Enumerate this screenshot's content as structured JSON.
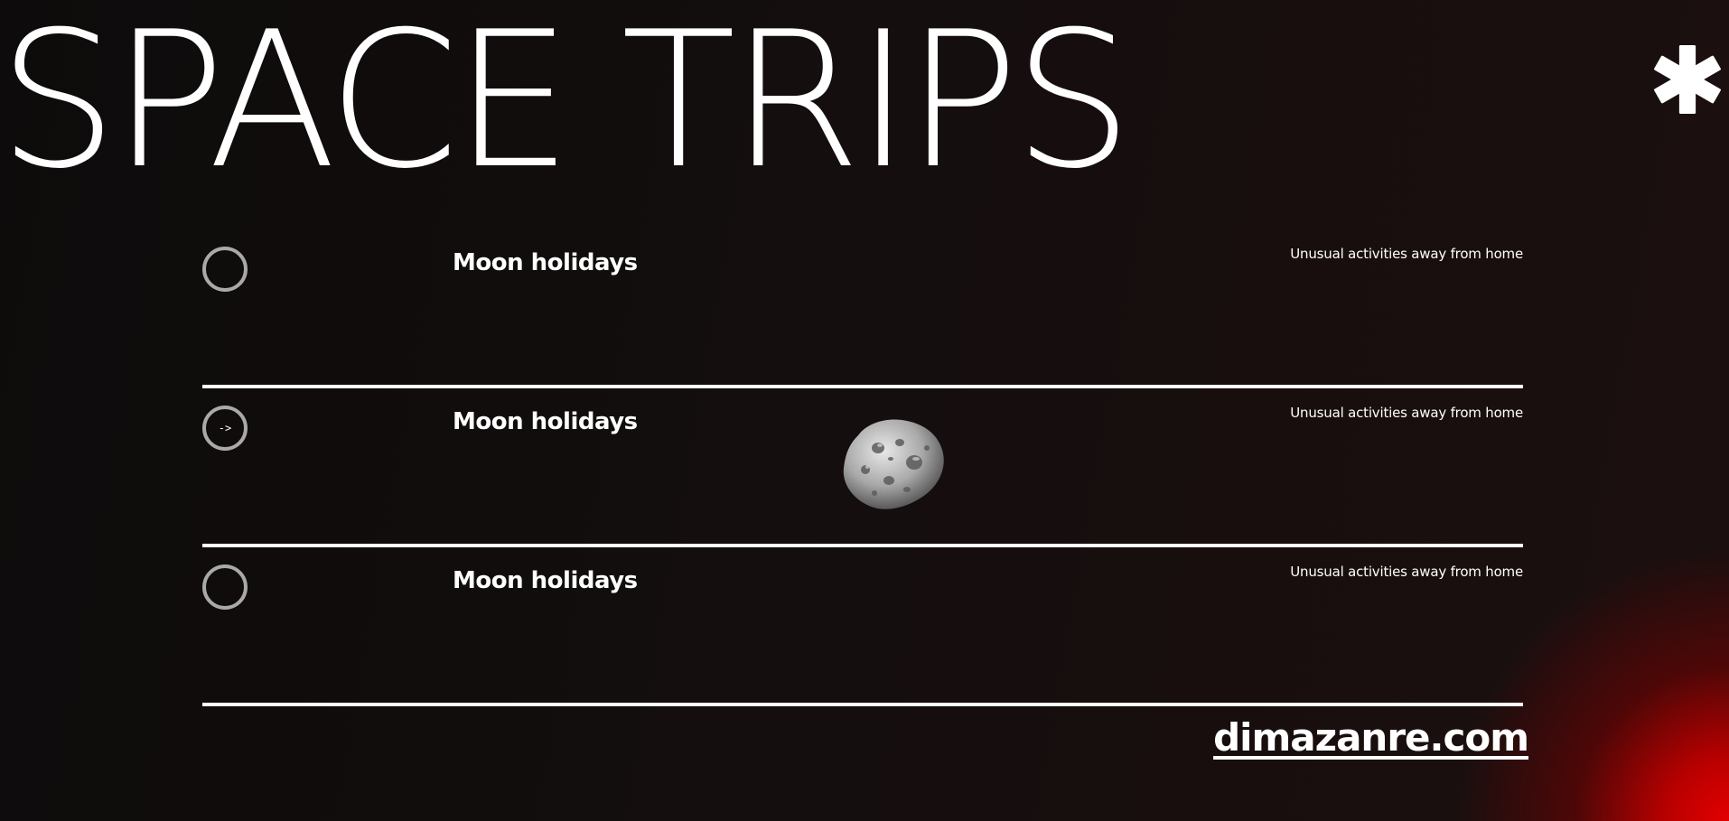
{
  "header": {
    "title": "SPACE TRIPS",
    "menu_icon": "asterisk-icon"
  },
  "trips": [
    {
      "title": "Moon holidays",
      "description": "Unusual activities away from home",
      "marker": ""
    },
    {
      "title": "Moon holidays",
      "description": "Unusual activities away from home",
      "marker": "->"
    },
    {
      "title": "Moon holidays",
      "description": "Unusual activities away from home",
      "marker": ""
    }
  ],
  "footer": {
    "link_text": "dimazanre.com"
  },
  "colors": {
    "background": "#120d0d",
    "accent_glow": "#e30000",
    "text": "#ffffff",
    "circle_border": "#a9a9a9"
  }
}
